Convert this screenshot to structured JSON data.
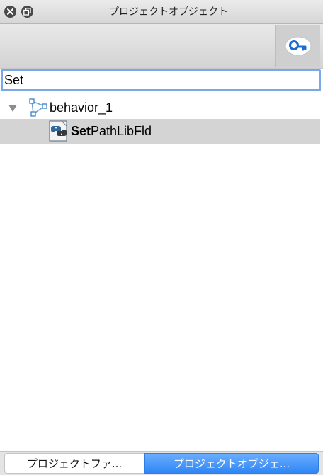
{
  "window": {
    "title": "プロジェクトオブジェクト"
  },
  "toolbar": {
    "search_toggle_icon": "search-icon"
  },
  "search": {
    "value": "Set"
  },
  "tree": {
    "root": {
      "label": "behavior_1",
      "icon": "behavior-graph-icon",
      "expanded": true
    },
    "child": {
      "match_text": "Set",
      "rest_text": "PathLibFld",
      "icon": "python-script-icon",
      "selected": true
    }
  },
  "tabs": [
    {
      "label": "プロジェクトファ...",
      "active": false
    },
    {
      "label": "プロジェクトオブジェ...",
      "active": true
    }
  ],
  "colors": {
    "accent": "#2f86f5",
    "focus_ring": "#7aa7e9",
    "selection": "#d4d4d4"
  }
}
